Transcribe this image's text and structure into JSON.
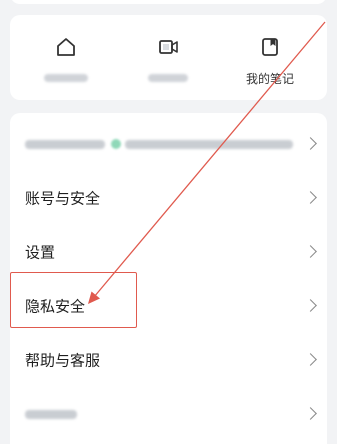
{
  "shortcuts": {
    "items": [
      {
        "label": "",
        "icon": "home-icon"
      },
      {
        "label": "",
        "icon": "video-icon"
      },
      {
        "label": "我的笔记",
        "icon": "note-icon"
      }
    ]
  },
  "menu": {
    "items": [
      {
        "label": ""
      },
      {
        "label": "账号与安全"
      },
      {
        "label": "设置"
      },
      {
        "label": "隐私安全"
      },
      {
        "label": "帮助与客服"
      },
      {
        "label": ""
      }
    ]
  },
  "annotation": {
    "color": "#e05a4e"
  }
}
